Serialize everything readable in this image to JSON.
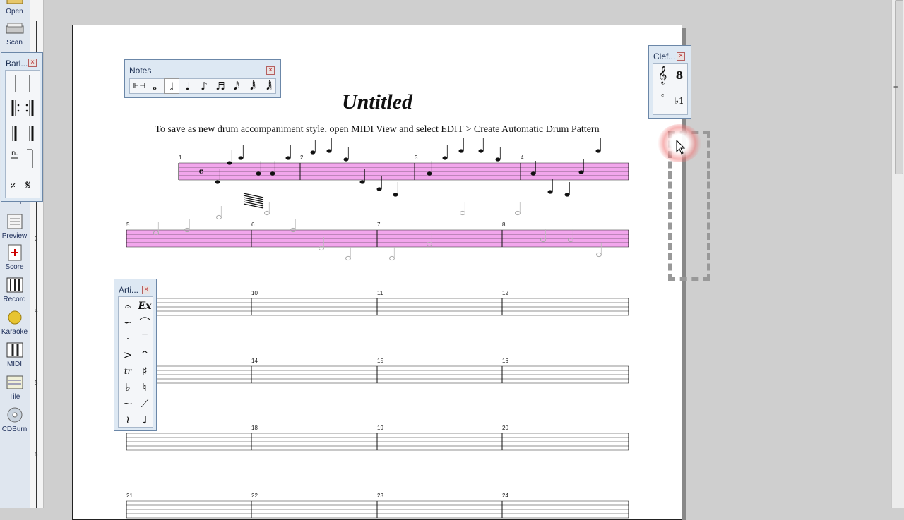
{
  "toolbar": {
    "buttons": [
      {
        "label": "Open"
      },
      {
        "label": "Scan"
      },
      {
        "label": "Setup"
      },
      {
        "label": "Preview"
      },
      {
        "label": "Score"
      },
      {
        "label": "Record"
      },
      {
        "label": "Karaoke"
      },
      {
        "label": "MIDI"
      },
      {
        "label": "Tile"
      },
      {
        "label": "CDBurn"
      }
    ]
  },
  "ruler": {
    "numbers": [
      "3",
      "4",
      "5",
      "6"
    ]
  },
  "score": {
    "title": "Untitled",
    "instructions": "To save as new drum accompaniment style, open MIDI View and select EDIT > Create Automatic Drum Pattern",
    "staff_highlight_color": "#f2a6ec",
    "measure_numbers": [
      "1",
      "2",
      "3",
      "4",
      "5",
      "6",
      "7",
      "8",
      "10",
      "11",
      "12",
      "14",
      "15",
      "16",
      "18",
      "19",
      "20",
      "21",
      "22",
      "23",
      "24"
    ]
  },
  "palettes": {
    "notes": {
      "title": "Notes",
      "close": "×"
    },
    "barlines": {
      "title": "Barl...",
      "close": "×"
    },
    "clef": {
      "title": "Clef...",
      "close": "×",
      "time_sig": "8",
      "key_label": "♭1"
    },
    "articulations": {
      "title": "Arti...",
      "close": "×",
      "ex_label": "Ex"
    }
  },
  "colors": {
    "palette_bg": "#dde8f3",
    "accent_close": "#b51a1a",
    "toolbar_bg": "#dfe6ef"
  }
}
